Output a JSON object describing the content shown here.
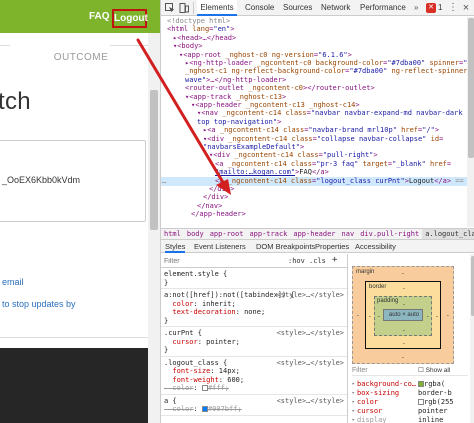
{
  "app": {
    "header": {
      "faq_label": "FAQ",
      "logout_label": "Logout",
      "header_color": "#7db42c"
    },
    "outcome_label": "OUTCOME",
    "heading_fragment": "tch",
    "code_text": "_OoEX6Kbb0kVdm",
    "email_link": "email",
    "updates_link": "to stop updates by"
  },
  "devtools": {
    "tabs": [
      "Elements",
      "Console",
      "Sources",
      "Network",
      "Performance"
    ],
    "active_tab": "Elements",
    "more_tabs": "»",
    "error_count": "1",
    "menu_icon": "⋮",
    "close_icon": "×",
    "dom_lines": [
      {
        "indent": 0,
        "html": "<span class=\"tok-gray\">&lt;!doctype html&gt;</span>"
      },
      {
        "indent": 0,
        "html": "<span class=\"tok-tag\">&lt;html</span> <span class=\"tok-attr\">lang</span>=<span class=\"tok-val\">\"en\"</span><span class=\"tok-tag\">&gt;</span>"
      },
      {
        "indent": 1,
        "html": "▸<span class=\"tok-tag\">&lt;head&gt;</span>…<span class=\"tok-tag\">&lt;/head&gt;</span>"
      },
      {
        "indent": 1,
        "html": "▾<span class=\"tok-tag\">&lt;body&gt;</span>"
      },
      {
        "indent": 2,
        "html": "▾<span class=\"tok-tag\">&lt;app-root</span> <span class=\"tok-attr\">_nghost-c0</span> <span class=\"tok-attr\">ng-version</span>=<span class=\"tok-val\">\"6.1.6\"</span><span class=\"tok-tag\">&gt;</span>"
      },
      {
        "indent": 3,
        "html": "▸<span class=\"tok-tag\">&lt;ng-http-loader</span> <span class=\"tok-attr\">_ngcontent-c0</span> <span class=\"tok-attr\">background-color</span>=<span class=\"tok-val\">\"#7dba00\"</span> <span class=\"tok-attr\">spinner</span>=<span class=\"tok-val\">\"sk-wave\"</span>"
      },
      {
        "indent": 3,
        "html": "<span class=\"tok-attr\">_nghost-c1</span> <span class=\"tok-attr\">ng-reflect-background-color</span>=<span class=\"tok-val\">\"#7dba00\"</span> <span class=\"tok-attr\">ng-reflect-spinner</span>=<span class=\"tok-val\">\"sk-</span>"
      },
      {
        "indent": 3,
        "html": "<span class=\"tok-val\">wave\"</span><span class=\"tok-tag\">&gt;</span>…<span class=\"tok-tag\">&lt;/ng-http-loader&gt;</span>"
      },
      {
        "indent": 3,
        "html": "<span class=\"tok-tag\">&lt;router-outlet</span> <span class=\"tok-attr\">_ngcontent-c0</span><span class=\"tok-tag\">&gt;&lt;/router-outlet&gt;</span>"
      },
      {
        "indent": 3,
        "html": "▾<span class=\"tok-tag\">&lt;app-track</span> <span class=\"tok-attr\">_nghost-c13</span><span class=\"tok-tag\">&gt;</span>"
      },
      {
        "indent": 4,
        "html": "▾<span class=\"tok-tag\">&lt;app-header</span> <span class=\"tok-attr\">_ngcontent-c13</span> <span class=\"tok-attr\">_nghost-c14</span><span class=\"tok-tag\">&gt;</span>"
      },
      {
        "indent": 5,
        "html": "▾<span class=\"tok-tag\">&lt;nav</span> <span class=\"tok-attr\">_ngcontent-c14</span> <span class=\"tok-attr\">class</span>=<span class=\"tok-val\">\"navbar navbar-expand-md navbar-dark fixed-</span>"
      },
      {
        "indent": 5,
        "html": "<span class=\"tok-val\">top top-navigation\"</span><span class=\"tok-tag\">&gt;</span>"
      },
      {
        "indent": 6,
        "html": "▸<span class=\"tok-tag\">&lt;a</span> <span class=\"tok-attr\">_ngcontent-c14</span> <span class=\"tok-attr\">class</span>=<span class=\"tok-val\">\"navbar-brand mrl10p\"</span> <span class=\"tok-attr\">href</span>=<span class=\"tok-val\">\"/\"</span><span class=\"tok-tag\">&gt;</span>"
      },
      {
        "indent": 6,
        "html": "▾<span class=\"tok-tag\">&lt;div</span> <span class=\"tok-attr\">_ngcontent-c14</span> <span class=\"tok-attr\">class</span>=<span class=\"tok-val\">\"collapse navbar-collapse\"</span> <span class=\"tok-attr\">id</span>="
      },
      {
        "indent": 6,
        "html": "<span class=\"tok-val\">\"navbarsExampleDefault\"</span><span class=\"tok-tag\">&gt;</span>"
      },
      {
        "indent": 7,
        "html": "▾<span class=\"tok-tag\">&lt;div</span> <span class=\"tok-attr\">_ngcontent-c14</span> <span class=\"tok-attr\">class</span>=<span class=\"tok-val\">\"pull-right\"</span><span class=\"tok-tag\">&gt;</span>"
      },
      {
        "indent": 8,
        "html": "<span class=\"tok-tag\">&lt;a</span> <span class=\"tok-attr\">_ngcontent-c14</span> <span class=\"tok-attr\">class</span>=<span class=\"tok-val\">\"pr-3 faq\"</span> <span class=\"tok-attr\">target</span>=<span class=\"tok-val\">\"_blank\"</span> <span class=\"tok-attr\">href</span>="
      },
      {
        "indent": 8,
        "html": "<span class=\"tok-val\" style=\"text-decoration:underline\">\"mailto:…kogan.com\"</span><span class=\"tok-tag\">&gt;</span><span class=\"tok-txt\">FAQ</span><span class=\"tok-tag\">&lt;/a&gt;</span>"
      },
      {
        "indent": 8,
        "html": "<span class=\"tok-tag\">&lt;a</span> <span class=\"tok-attr\">_ngcontent-c14</span> <span class=\"tok-attr\">class</span>=<span class=\"tok-val\">\"logout_class curPnt\"</span><span class=\"tok-tag\">&gt;</span><span class=\"tok-txt\">Logout</span><span class=\"tok-tag\">&lt;/a&gt;</span> <span class=\"tok-gray\">== $0</span>",
        "selected": true
      },
      {
        "indent": 7,
        "html": "<span class=\"tok-tag\">&lt;/div&gt;</span>"
      },
      {
        "indent": 6,
        "html": "<span class=\"tok-tag\">&lt;/div&gt;</span>"
      },
      {
        "indent": 5,
        "html": "<span class=\"tok-tag\">&lt;/nav&gt;</span>"
      },
      {
        "indent": 4,
        "html": "<span class=\"tok-tag\">&lt;/app-header&gt;</span>"
      }
    ],
    "breadcrumb": [
      "html",
      "body",
      "app-root",
      "app-track",
      "app-header",
      "nav",
      "div.pull-right",
      "a.logout_class.curPnt"
    ],
    "sub_tabs": [
      "Styles",
      "Event Listeners",
      "DOM Breakpoints",
      "Properties",
      "Accessibility"
    ],
    "filter_placeholder": "Filter",
    "filter_hov": ":hov",
    "filter_cls": ".cls",
    "filter_add": "+",
    "style_rules": [
      {
        "lines": [
          "element.style {",
          "}"
        ]
      },
      {
        "lines": [
          "a:not([href]):not([tabindex]) {",
          "  color: inherit;",
          "  text-decoration: none;",
          "}"
        ],
        "src": "<style>…</style>"
      },
      {
        "lines": [
          ".curPnt {",
          "  cursor: pointer;",
          "}"
        ],
        "src": "<style>…</style>"
      },
      {
        "lines": [
          ".logout_class {",
          "  font-size: 14px;",
          "  font-weight: 600;",
          "  color: #fff;"
        ],
        "src": "<style>…</style>"
      },
      {
        "lines": [
          "a {",
          "  color: #007bff;"
        ],
        "src": "<style>…</style>"
      }
    ],
    "box_model": {
      "margin_label": "margin",
      "border_label": "border",
      "padding_label": "padding",
      "content_label": "auto × auto",
      "dash": "-"
    },
    "computed_filter": "Filter",
    "computed_show_all": "Show all",
    "computed": [
      {
        "prop": "background-co…",
        "val": "rgba(",
        "swatch": true
      },
      {
        "prop": "box-sizing",
        "val": "border-b"
      },
      {
        "prop": "color",
        "val": "rgb(255",
        "swatch": true
      },
      {
        "prop": "cursor",
        "val": "pointer"
      },
      {
        "prop": "display",
        "val": "inline"
      }
    ]
  }
}
